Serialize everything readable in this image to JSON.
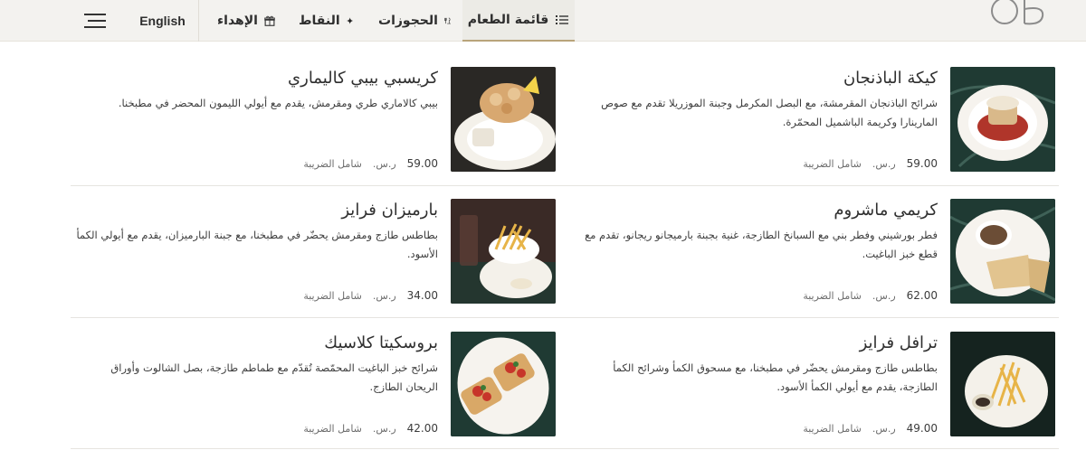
{
  "header": {
    "nav": {
      "menu_label": "قائمة الطعام",
      "reservations_label": "الحجوزات",
      "points_label": "النقاط",
      "gifting_label": "الإهداء",
      "language_label": "English"
    },
    "icons": {
      "menu": "list-icon",
      "reservations": "utensils-icon",
      "points": "sparkle-icon",
      "gifting": "gift-icon",
      "hamburger": "hamburger-icon"
    },
    "colors": {
      "accent": "#b9a47a",
      "header_bg": "#f3f2ef"
    }
  },
  "menu": {
    "items": [
      {
        "title": "كيكة الباذنجان",
        "description": "شرائح الباذنجان المقرمشة، مع البصل المكرمل وجبنة الموزريلا تقدم مع صوص المارينارا وكريمة الباشميل المحمّرة.",
        "price": "59.00",
        "currency": "ر.س.",
        "tax_note": "شامل الضريبة"
      },
      {
        "title": "كريسبي بيبي كاليماري",
        "description": "بيبي كالاماري طري ومقرمش، يقدم مع أيولي الليمون المحضر في مطبخنا.",
        "price": "59.00",
        "currency": "ر.س.",
        "tax_note": "شامل الضريبة"
      },
      {
        "title": "كريمي ماشروم",
        "description": "فطر بورشيني وفطر بني مع السبانخ الطازجة، غنية بجبنة بارميجانو ريجانو، تقدم مع قطع خبز الباغيت.",
        "price": "62.00",
        "currency": "ر.س.",
        "tax_note": "شامل الضريبة"
      },
      {
        "title": "بارميزان فرايز",
        "description": "بطاطس طازج ومقرمش يحضّر في مطبخنا، مع جبنة البارميزان، يقدم مع أيولي الكمأ الأسود.",
        "price": "34.00",
        "currency": "ر.س.",
        "tax_note": "شامل الضريبة"
      },
      {
        "title": "ترافل فرايز",
        "description": "بطاطس طازج ومقرمش يحضّر في مطبخنا، مع مسحوق الكمأ وشرائح الكمأ الطازجة، يقدم مع أيولي الكمأ الأسود.",
        "price": "49.00",
        "currency": "ر.س.",
        "tax_note": "شامل الضريبة"
      },
      {
        "title": "بروسكيتا كلاسيك",
        "description": "شرائح خبز الباغيت المحمّصة تُقدّم مع طماطم طازجة، بصل الشالوت وأوراق الريحان الطازج.",
        "price": "42.00",
        "currency": "ر.س.",
        "tax_note": "شامل الضريبة"
      }
    ]
  }
}
